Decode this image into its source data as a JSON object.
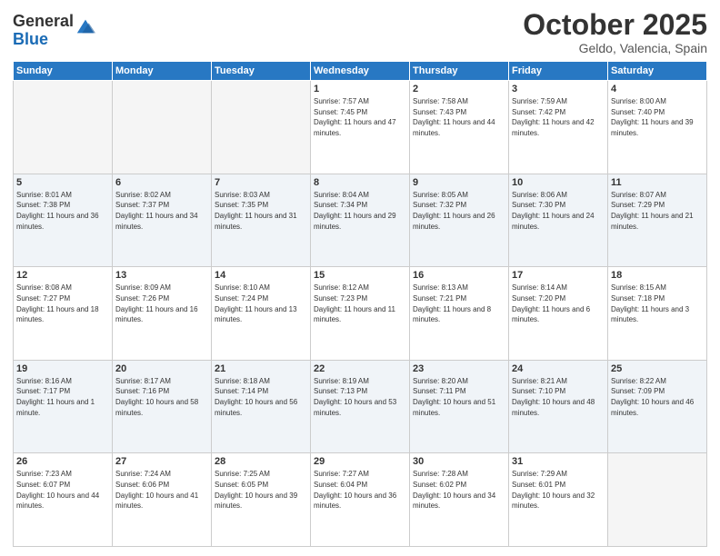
{
  "logo": {
    "general": "General",
    "blue": "Blue"
  },
  "header": {
    "title": "October 2025",
    "subtitle": "Geldo, Valencia, Spain"
  },
  "weekdays": [
    "Sunday",
    "Monday",
    "Tuesday",
    "Wednesday",
    "Thursday",
    "Friday",
    "Saturday"
  ],
  "weeks": [
    [
      {
        "day": "",
        "sunrise": "",
        "sunset": "",
        "daylight": ""
      },
      {
        "day": "",
        "sunrise": "",
        "sunset": "",
        "daylight": ""
      },
      {
        "day": "",
        "sunrise": "",
        "sunset": "",
        "daylight": ""
      },
      {
        "day": "1",
        "sunrise": "Sunrise: 7:57 AM",
        "sunset": "Sunset: 7:45 PM",
        "daylight": "Daylight: 11 hours and 47 minutes."
      },
      {
        "day": "2",
        "sunrise": "Sunrise: 7:58 AM",
        "sunset": "Sunset: 7:43 PM",
        "daylight": "Daylight: 11 hours and 44 minutes."
      },
      {
        "day": "3",
        "sunrise": "Sunrise: 7:59 AM",
        "sunset": "Sunset: 7:42 PM",
        "daylight": "Daylight: 11 hours and 42 minutes."
      },
      {
        "day": "4",
        "sunrise": "Sunrise: 8:00 AM",
        "sunset": "Sunset: 7:40 PM",
        "daylight": "Daylight: 11 hours and 39 minutes."
      }
    ],
    [
      {
        "day": "5",
        "sunrise": "Sunrise: 8:01 AM",
        "sunset": "Sunset: 7:38 PM",
        "daylight": "Daylight: 11 hours and 36 minutes."
      },
      {
        "day": "6",
        "sunrise": "Sunrise: 8:02 AM",
        "sunset": "Sunset: 7:37 PM",
        "daylight": "Daylight: 11 hours and 34 minutes."
      },
      {
        "day": "7",
        "sunrise": "Sunrise: 8:03 AM",
        "sunset": "Sunset: 7:35 PM",
        "daylight": "Daylight: 11 hours and 31 minutes."
      },
      {
        "day": "8",
        "sunrise": "Sunrise: 8:04 AM",
        "sunset": "Sunset: 7:34 PM",
        "daylight": "Daylight: 11 hours and 29 minutes."
      },
      {
        "day": "9",
        "sunrise": "Sunrise: 8:05 AM",
        "sunset": "Sunset: 7:32 PM",
        "daylight": "Daylight: 11 hours and 26 minutes."
      },
      {
        "day": "10",
        "sunrise": "Sunrise: 8:06 AM",
        "sunset": "Sunset: 7:30 PM",
        "daylight": "Daylight: 11 hours and 24 minutes."
      },
      {
        "day": "11",
        "sunrise": "Sunrise: 8:07 AM",
        "sunset": "Sunset: 7:29 PM",
        "daylight": "Daylight: 11 hours and 21 minutes."
      }
    ],
    [
      {
        "day": "12",
        "sunrise": "Sunrise: 8:08 AM",
        "sunset": "Sunset: 7:27 PM",
        "daylight": "Daylight: 11 hours and 18 minutes."
      },
      {
        "day": "13",
        "sunrise": "Sunrise: 8:09 AM",
        "sunset": "Sunset: 7:26 PM",
        "daylight": "Daylight: 11 hours and 16 minutes."
      },
      {
        "day": "14",
        "sunrise": "Sunrise: 8:10 AM",
        "sunset": "Sunset: 7:24 PM",
        "daylight": "Daylight: 11 hours and 13 minutes."
      },
      {
        "day": "15",
        "sunrise": "Sunrise: 8:12 AM",
        "sunset": "Sunset: 7:23 PM",
        "daylight": "Daylight: 11 hours and 11 minutes."
      },
      {
        "day": "16",
        "sunrise": "Sunrise: 8:13 AM",
        "sunset": "Sunset: 7:21 PM",
        "daylight": "Daylight: 11 hours and 8 minutes."
      },
      {
        "day": "17",
        "sunrise": "Sunrise: 8:14 AM",
        "sunset": "Sunset: 7:20 PM",
        "daylight": "Daylight: 11 hours and 6 minutes."
      },
      {
        "day": "18",
        "sunrise": "Sunrise: 8:15 AM",
        "sunset": "Sunset: 7:18 PM",
        "daylight": "Daylight: 11 hours and 3 minutes."
      }
    ],
    [
      {
        "day": "19",
        "sunrise": "Sunrise: 8:16 AM",
        "sunset": "Sunset: 7:17 PM",
        "daylight": "Daylight: 11 hours and 1 minute."
      },
      {
        "day": "20",
        "sunrise": "Sunrise: 8:17 AM",
        "sunset": "Sunset: 7:16 PM",
        "daylight": "Daylight: 10 hours and 58 minutes."
      },
      {
        "day": "21",
        "sunrise": "Sunrise: 8:18 AM",
        "sunset": "Sunset: 7:14 PM",
        "daylight": "Daylight: 10 hours and 56 minutes."
      },
      {
        "day": "22",
        "sunrise": "Sunrise: 8:19 AM",
        "sunset": "Sunset: 7:13 PM",
        "daylight": "Daylight: 10 hours and 53 minutes."
      },
      {
        "day": "23",
        "sunrise": "Sunrise: 8:20 AM",
        "sunset": "Sunset: 7:11 PM",
        "daylight": "Daylight: 10 hours and 51 minutes."
      },
      {
        "day": "24",
        "sunrise": "Sunrise: 8:21 AM",
        "sunset": "Sunset: 7:10 PM",
        "daylight": "Daylight: 10 hours and 48 minutes."
      },
      {
        "day": "25",
        "sunrise": "Sunrise: 8:22 AM",
        "sunset": "Sunset: 7:09 PM",
        "daylight": "Daylight: 10 hours and 46 minutes."
      }
    ],
    [
      {
        "day": "26",
        "sunrise": "Sunrise: 7:23 AM",
        "sunset": "Sunset: 6:07 PM",
        "daylight": "Daylight: 10 hours and 44 minutes."
      },
      {
        "day": "27",
        "sunrise": "Sunrise: 7:24 AM",
        "sunset": "Sunset: 6:06 PM",
        "daylight": "Daylight: 10 hours and 41 minutes."
      },
      {
        "day": "28",
        "sunrise": "Sunrise: 7:25 AM",
        "sunset": "Sunset: 6:05 PM",
        "daylight": "Daylight: 10 hours and 39 minutes."
      },
      {
        "day": "29",
        "sunrise": "Sunrise: 7:27 AM",
        "sunset": "Sunset: 6:04 PM",
        "daylight": "Daylight: 10 hours and 36 minutes."
      },
      {
        "day": "30",
        "sunrise": "Sunrise: 7:28 AM",
        "sunset": "Sunset: 6:02 PM",
        "daylight": "Daylight: 10 hours and 34 minutes."
      },
      {
        "day": "31",
        "sunrise": "Sunrise: 7:29 AM",
        "sunset": "Sunset: 6:01 PM",
        "daylight": "Daylight: 10 hours and 32 minutes."
      },
      {
        "day": "",
        "sunrise": "",
        "sunset": "",
        "daylight": ""
      }
    ]
  ]
}
